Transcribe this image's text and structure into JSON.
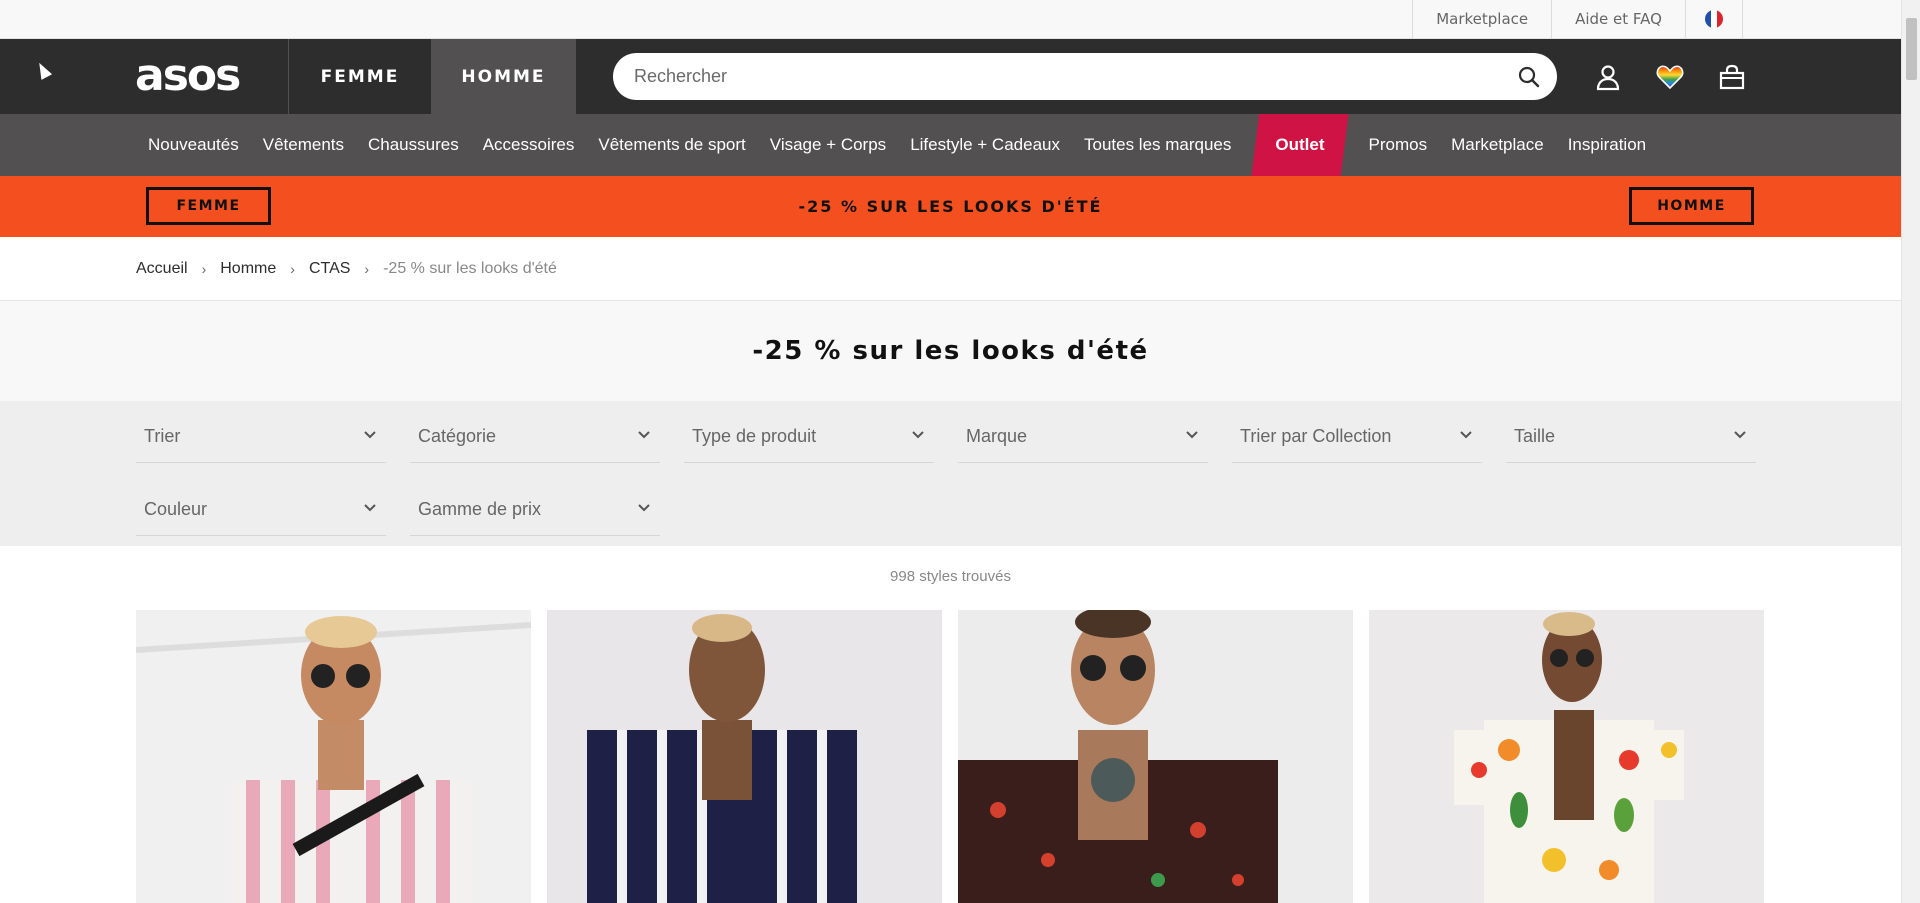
{
  "utility": {
    "links": [
      "Marketplace",
      "Aide et FAQ"
    ]
  },
  "header": {
    "logo": "asos",
    "tabs": [
      "FEMME",
      "HOMME"
    ],
    "search_placeholder": "Rechercher"
  },
  "nav": {
    "items": [
      "Nouveautés",
      "Vêtements",
      "Chaussures",
      "Accessoires",
      "Vêtements de sport",
      "Visage + Corps",
      "Lifestyle + Cadeaux",
      "Toutes les marques",
      "Outlet",
      "Promos",
      "Marketplace",
      "Inspiration"
    ]
  },
  "promo": {
    "left": "FEMME",
    "text": "-25 % SUR LES LOOKS D'ÉTÉ",
    "right": "HOMME"
  },
  "breadcrumb": {
    "items": [
      "Accueil",
      "Homme",
      "CTAS",
      "-25 % sur les looks d'été"
    ]
  },
  "page": {
    "title": "-25 % sur les looks d'été",
    "count": "998 styles trouvés"
  },
  "filters": [
    "Trier",
    "Catégorie",
    "Type de produit",
    "Marque",
    "Trier par Collection",
    "Taille",
    "Couleur",
    "Gamme de prix"
  ],
  "colors": {
    "header": "#2d2d2d",
    "nav": "#525050",
    "promo": "#f4501f",
    "outlet": "#d01345"
  },
  "products": [
    {
      "shirt": "pink-stripe"
    },
    {
      "shirt": "navy-stripe"
    },
    {
      "shirt": "dark-print"
    },
    {
      "shirt": "fruit-print"
    }
  ]
}
